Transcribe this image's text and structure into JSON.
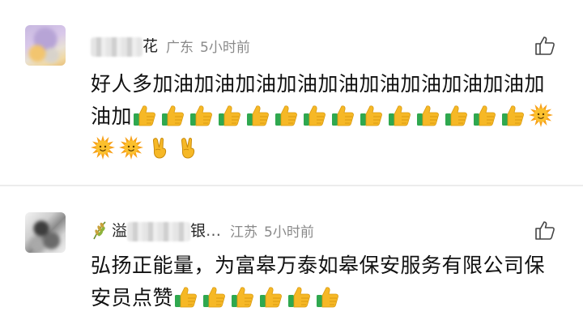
{
  "comments": [
    {
      "username_visible": "花",
      "location": "广东",
      "time": "5小时前",
      "text": "好人多加油加油加油加油加油加油加油加油加油加油加",
      "emojis": [
        "thumbs-up-icon",
        "thumbs-up-icon",
        "thumbs-up-icon",
        "thumbs-up-icon",
        "thumbs-up-icon",
        "thumbs-up-icon",
        "thumbs-up-icon",
        "thumbs-up-icon",
        "thumbs-up-icon",
        "thumbs-up-icon",
        "thumbs-up-icon",
        "thumbs-up-icon",
        "thumbs-up-icon",
        "thumbs-up-icon",
        "sun-icon",
        "sun-icon",
        "sun-icon",
        "victory-hand-icon",
        "victory-hand-icon"
      ]
    },
    {
      "username_visible_start": "溢",
      "username_visible_end": "银",
      "username_ellipsis": "…",
      "location": "江苏",
      "time": "5小时前",
      "text": "弘扬正能量，为富皋万泰如皋保安服务有限公司保安员点赞",
      "emojis": [
        "thumbs-up-icon",
        "thumbs-up-icon",
        "thumbs-up-icon",
        "thumbs-up-icon",
        "thumbs-up-icon",
        "thumbs-up-icon"
      ]
    }
  ],
  "colors": {
    "thumb": "#f6b826",
    "cuff": "#2fa84f",
    "sun": "#f7a21b",
    "meta": "#8a8a8a"
  }
}
